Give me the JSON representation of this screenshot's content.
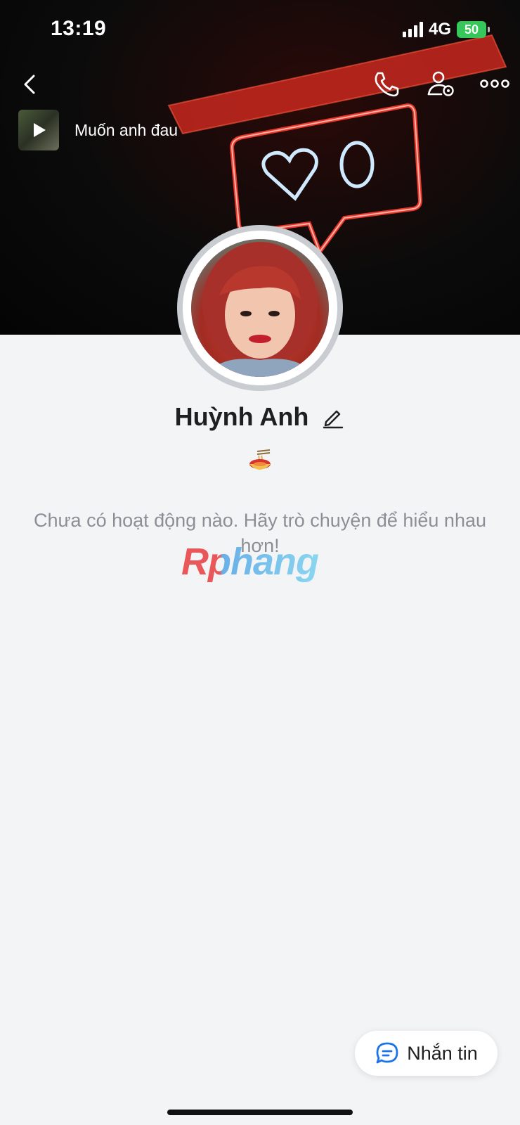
{
  "status_bar": {
    "time": "13:19",
    "network": "4G",
    "battery": "50"
  },
  "header": {
    "back_icon": "chevron-left-icon",
    "call_icon": "phone-icon",
    "settings_icon": "user-settings-icon",
    "more_icon": "more-horizontal-icon"
  },
  "music": {
    "title": "Muốn anh đau"
  },
  "profile": {
    "name": "Huỳnh Anh",
    "status_emoji_icon": "noodle-bowl-icon",
    "empty_message": "Chưa có hoạt động nào. Hãy trò chuyện để hiểu nhau hơn!"
  },
  "watermark": {
    "text": "Rphang"
  },
  "actions": {
    "message_label": "Nhắn tin"
  },
  "colors": {
    "accent": "#1a73e8",
    "background": "#f3f4f6",
    "battery": "#35c759"
  }
}
